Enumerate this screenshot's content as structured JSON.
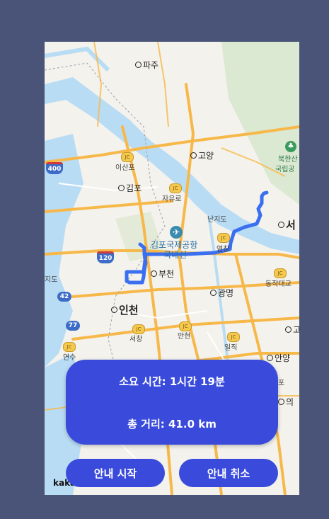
{
  "map": {
    "provider_logo": "kakao",
    "places": [
      {
        "name": "파주",
        "type": "city"
      },
      {
        "name": "고양",
        "type": "city"
      },
      {
        "name": "김포",
        "type": "city"
      },
      {
        "name": "부천",
        "type": "city"
      },
      {
        "name": "인천",
        "type": "major-city"
      },
      {
        "name": "광명",
        "type": "city"
      },
      {
        "name": "안양",
        "type": "city"
      },
      {
        "name": "서",
        "type": "major-city"
      },
      {
        "name": "고",
        "type": "city"
      },
      {
        "name": "의",
        "type": "city"
      },
      {
        "name": "이산포",
        "type": "junction"
      },
      {
        "name": "자유로",
        "type": "junction"
      },
      {
        "name": "난지도",
        "type": "area"
      },
      {
        "name": "김포국제공항",
        "type": "airport"
      },
      {
        "name": "국내선",
        "type": "airport"
      },
      {
        "name": "염창",
        "type": "junction"
      },
      {
        "name": "안현",
        "type": "junction"
      },
      {
        "name": "서창",
        "type": "junction"
      },
      {
        "name": "연수",
        "type": "junction"
      },
      {
        "name": "일직",
        "type": "junction"
      },
      {
        "name": "동작대교",
        "type": "junction"
      },
      {
        "name": "지도",
        "type": "area"
      },
      {
        "name": "북한산",
        "type": "park"
      },
      {
        "name": "국립공",
        "type": "park"
      },
      {
        "name": "포",
        "type": "area"
      }
    ],
    "route_shields": [
      "400",
      "120",
      "42",
      "77"
    ],
    "jc_label": "JC",
    "colors": {
      "route": "#3a6ff0",
      "water": "#b9dcf5",
      "highway": "#f7b84a"
    }
  },
  "route_info": {
    "time_label": "소요 시간: 1시간 19분",
    "distance_label": "총 거리: 41.0 km"
  },
  "actions": {
    "start_label": "안내 시작",
    "cancel_label": "안내 취소"
  },
  "colors": {
    "accent": "#3a4bdc",
    "background": "#4a5478"
  }
}
